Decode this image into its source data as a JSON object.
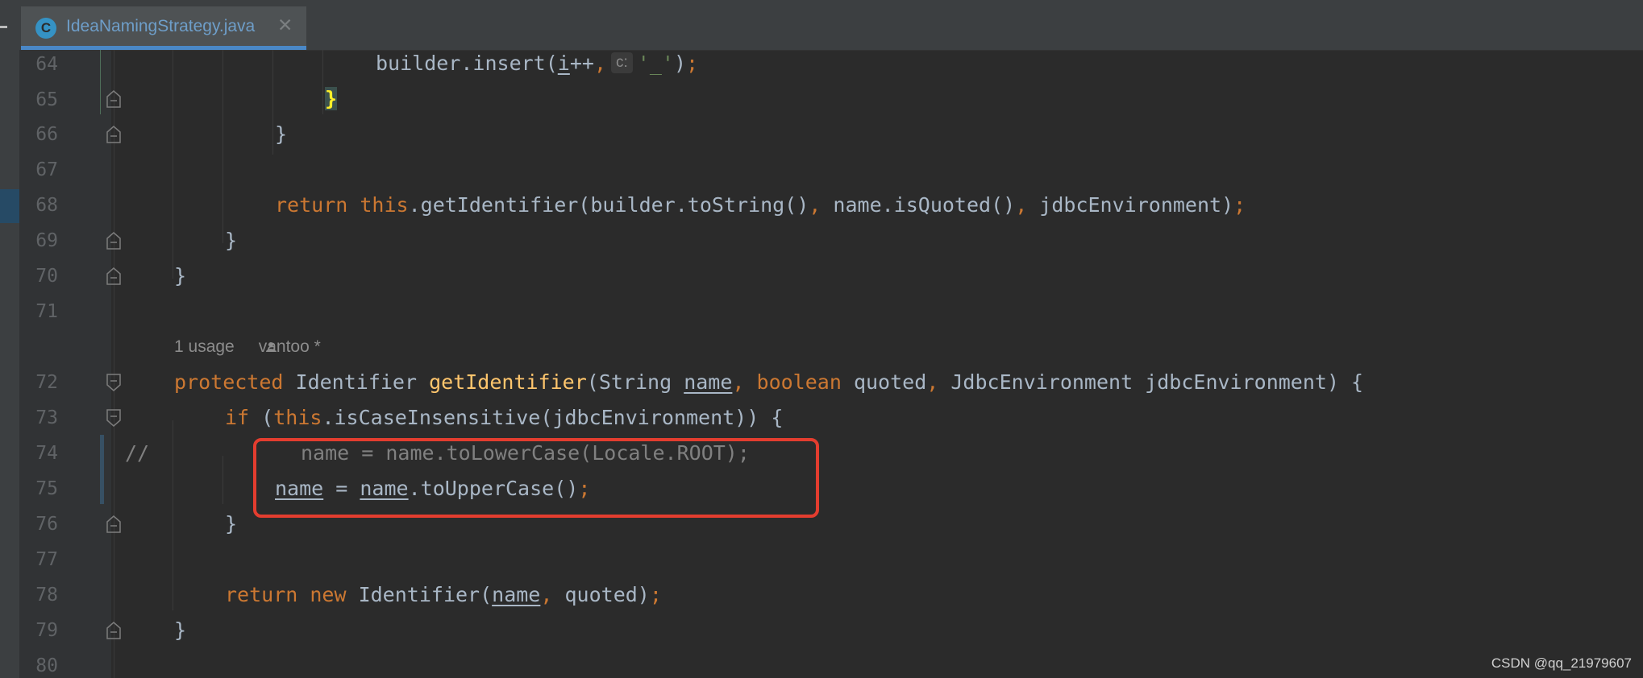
{
  "editor": {
    "tab": {
      "icon_letter": "C",
      "file_name": "IdeaNamingStrategy.java",
      "close_glyph": "✕"
    },
    "accent_color": "#4a88c7",
    "highlight_color": "#e33d2f"
  },
  "gutter": {
    "line_numbers": [
      "64",
      "65",
      "66",
      "67",
      "68",
      "69",
      "70",
      "71",
      "72",
      "73",
      "74",
      "75",
      "76",
      "77",
      "78",
      "79",
      "80"
    ]
  },
  "code": {
    "line64": {
      "pre": "builder.insert(",
      "var": "i",
      "post1": "++",
      "comma": ",",
      "param_hint": "c:",
      "str": "'_'",
      "close": ")",
      "semi": ";"
    },
    "line65": {
      "brace": "}"
    },
    "line66": {
      "brace": "}"
    },
    "line68": {
      "ret": "return",
      "this": "this",
      "rest1": ".getIdentifier(builder.toString()",
      "c1": ",",
      "rest2": " name.isQuoted()",
      "c2": ",",
      "rest3": " jdbcEnvironment)",
      "semi": ";"
    },
    "line69": {
      "brace": "}"
    },
    "line70": {
      "brace": "}"
    },
    "usage_hint": {
      "count": "1 usage",
      "author": "vantoo *"
    },
    "line72": {
      "mod": "protected",
      "type": " Identifier ",
      "fn": "getIdentifier",
      "p1": "(String ",
      "name": "name",
      "c1": ",",
      "bool": " boolean",
      "p2": " quoted",
      "c2": ",",
      "p3": " JdbcEnvironment jdbcEnvironment) {"
    },
    "line73": {
      "kw": "if",
      "p1": " (",
      "this": "this",
      "p2": ".isCaseInsensitive(jdbcEnvironment)) {"
    },
    "line74": {
      "marker": "//",
      "text": "name = name.toLowerCase(Locale.ROOT);"
    },
    "line75": {
      "name1": "name",
      "eq": " = ",
      "name2": "name",
      "rest": ".toUpperCase()",
      "semi": ";"
    },
    "line76": {
      "brace": "}"
    },
    "line78": {
      "ret": "return",
      "new": " new",
      "rest1": " Identifier(",
      "name": "name",
      "c1": ",",
      "rest2": " quoted)",
      "semi": ";"
    },
    "line79": {
      "brace": "}"
    }
  },
  "watermark": "CSDN @qq_21979607"
}
